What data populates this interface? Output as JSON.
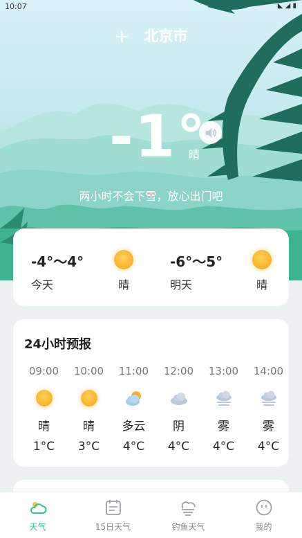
{
  "status_bar": {
    "time": "10:07"
  },
  "header": {
    "add_icon": "plus-icon",
    "city": "北京市"
  },
  "current": {
    "temperature": "-1°",
    "condition": "晴",
    "tip": "两小时不会下雪，放心出门吧",
    "speaker_icon": "speaker-icon"
  },
  "daily": [
    {
      "range": "-4°～4°",
      "label": "今天",
      "condition": "晴",
      "icon": "sun-icon"
    },
    {
      "range": "-6°～5°",
      "label": "明天",
      "condition": "晴",
      "icon": "sun-icon"
    }
  ],
  "hourly": {
    "title": "24小时预报",
    "items": [
      {
        "time": "09:00",
        "condition": "晴",
        "temp": "1°C",
        "icon": "sun-icon"
      },
      {
        "time": "10:00",
        "condition": "晴",
        "temp": "3°C",
        "icon": "sun-icon"
      },
      {
        "time": "11:00",
        "condition": "多云",
        "temp": "4°C",
        "icon": "partly-cloudy-icon"
      },
      {
        "time": "12:00",
        "condition": "阴",
        "temp": "4°C",
        "icon": "cloud-icon"
      },
      {
        "time": "13:00",
        "condition": "雾",
        "temp": "4°C",
        "icon": "fog-icon"
      },
      {
        "time": "14:00",
        "condition": "雾",
        "temp": "4°C",
        "icon": "fog-icon"
      }
    ]
  },
  "nav": [
    {
      "label": "天气",
      "icon": "weather-cloud-icon",
      "active": true
    },
    {
      "label": "15日天气",
      "icon": "calendar-icon",
      "active": false
    },
    {
      "label": "钓鱼天气",
      "icon": "wind-cloud-icon",
      "active": false
    },
    {
      "label": "我的",
      "icon": "smiley-icon",
      "active": false
    }
  ],
  "colors": {
    "accent": "#2fc19a",
    "sun": "#fbb22b",
    "sky_top": "#d9f0f7",
    "mountain": "#8ed8cc"
  }
}
